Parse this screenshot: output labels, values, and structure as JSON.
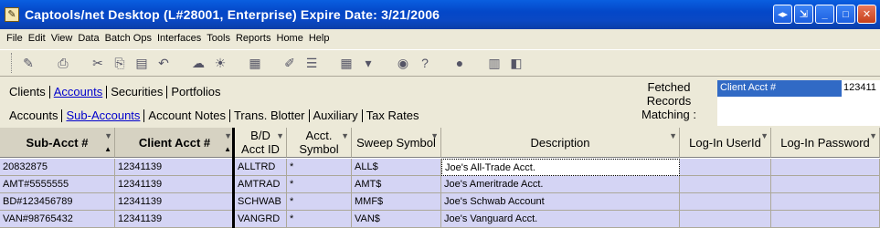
{
  "window": {
    "title": "Captools/net Desktop  (L#28001, Enterprise) Expire Date: 3/21/2006",
    "icon_glyph": "✎"
  },
  "menubar": [
    "File",
    "Edit",
    "View",
    "Data",
    "Batch Ops",
    "Interfaces",
    "Tools",
    "Reports",
    "Home",
    "Help"
  ],
  "toolbar_icons": [
    "edit-icon",
    "print-icon",
    "cut-icon",
    "copy-icon",
    "paste-icon",
    "undo-icon",
    "grab-icon",
    "weather-icon",
    "calculator-icon",
    "notepad-icon",
    "list-icon",
    "grid-icon",
    "dropdown-icon",
    "globe-icon",
    "help-icon",
    "ball-icon",
    "calendar-icon",
    "exit-icon"
  ],
  "toolbar_glyphs": [
    "✎",
    "⎙",
    "✂",
    "⎘",
    "▤",
    "↶",
    "☁",
    "☀",
    "▦",
    "✐",
    "☰",
    "▦",
    "▾",
    "◉",
    "?",
    "●",
    "▥",
    "◧"
  ],
  "tabs_row1": [
    "Clients",
    "Accounts",
    "Securities",
    "Portfolios"
  ],
  "tabs_row1_active": "Accounts",
  "tabs_row2": [
    "Accounts",
    "Sub-Accounts",
    "Account Notes",
    "Trans. Blotter",
    "Auxiliary",
    "Tax Rates"
  ],
  "tabs_row2_active": "Sub-Accounts",
  "fetched_label": "Fetched\nRecords\nMatching :",
  "filter": {
    "label": "Client Acct #",
    "value": "123411"
  },
  "columns": [
    "Sub-Acct #",
    "Client Acct #",
    "B/D\nAcct ID",
    "Acct.\nSymbol",
    "Sweep Symbol",
    "Description",
    "Log-In UserId",
    "Log-In Password"
  ],
  "rows": [
    [
      "20832875",
      "12341139",
      "ALLTRD",
      "*",
      "ALL$",
      "Joe's All-Trade Acct.",
      "",
      ""
    ],
    [
      "AMT#5555555",
      "12341139",
      "AMTRAD",
      "*",
      "AMT$",
      "Joe's Ameritrade Acct.",
      "",
      ""
    ],
    [
      "BD#123456789",
      "12341139",
      "SCHWAB",
      "*",
      "MMF$",
      "Joe's Schwab Account",
      "",
      ""
    ],
    [
      "VAN#98765432",
      "12341139",
      "VANGRD",
      "*",
      "VAN$",
      "Joe's Vanguard Acct.",
      "",
      ""
    ]
  ],
  "colors": {
    "row_bg": "#d4d4f4",
    "title_blue": "#0447c8",
    "selection": "#316ac5"
  }
}
